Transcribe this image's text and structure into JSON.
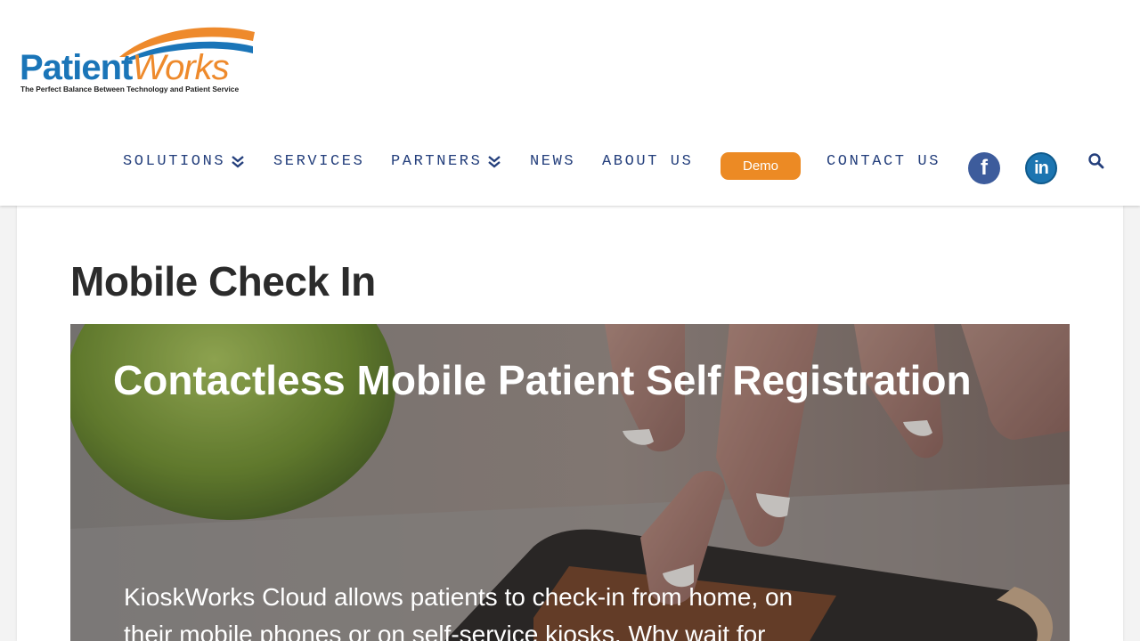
{
  "header": {
    "logo": {
      "word_primary": "Patient",
      "word_secondary": "Works",
      "tagline": "The Perfect Balance Between Technology and Patient Service",
      "colors": {
        "primary": "#1a75b8",
        "secondary": "#ee8a2c"
      }
    },
    "nav": {
      "items": [
        {
          "label": "SOLUTIONS",
          "has_dropdown": true
        },
        {
          "label": "SERVICES",
          "has_dropdown": false
        },
        {
          "label": "PARTNERS",
          "has_dropdown": true
        },
        {
          "label": "NEWS",
          "has_dropdown": false
        },
        {
          "label": "ABOUT US",
          "has_dropdown": false
        },
        {
          "label": "CONTACT US",
          "has_dropdown": false
        }
      ],
      "demo_button": "Demo",
      "social": [
        {
          "icon": "facebook-icon",
          "glyph": "f"
        },
        {
          "icon": "linkedin-icon",
          "glyph": "in"
        }
      ],
      "search_icon": "search-icon",
      "colors": {
        "nav_text": "#243f7c",
        "demo_bg": "#ec8a24"
      }
    }
  },
  "main": {
    "title": "Mobile Check In",
    "hero": {
      "title": "Contactless Mobile Patient Self Registration",
      "body": "KioskWorks Cloud allows patients to check-in from home, on their mobile phones or on self-service kiosks. Why wait for"
    }
  }
}
